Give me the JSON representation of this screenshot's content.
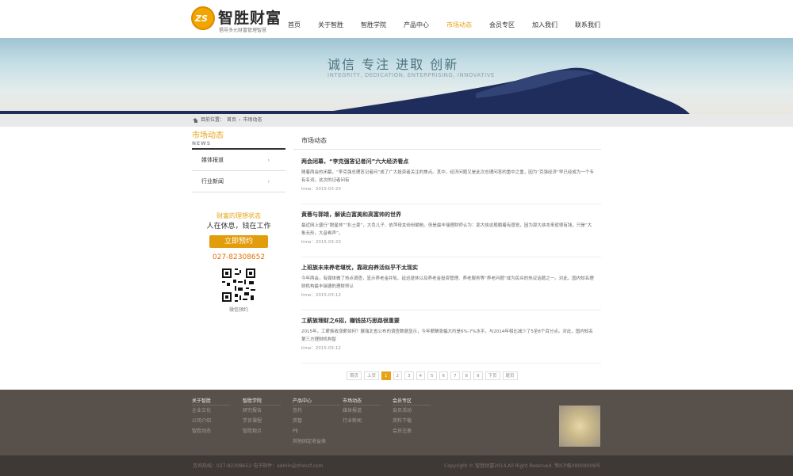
{
  "header": {
    "brand": "智胜财富",
    "logo_mark": "ZS",
    "slogan": "倡导多元财富管理智慧",
    "nav": [
      "首页",
      "关于智胜",
      "智胜学院",
      "产品中心",
      "市场动态",
      "会员专区",
      "加入我们",
      "联系我们"
    ],
    "active_nav": "市场动态"
  },
  "banner": {
    "title": "诚信 专注 进取 创新",
    "subtitle": "INTEGRITY, DEDICATION, ENTERPRISING, INNOVATIVE"
  },
  "breadcrumb": {
    "prefix": "目前位置：",
    "items": [
      "首页",
      "市场动态"
    ],
    "separator": "›"
  },
  "sidebar": {
    "title": "市场动态",
    "title_en": "NEWS",
    "items": [
      {
        "label": "媒体报道",
        "arrow": "›"
      },
      {
        "label": "行业新闻",
        "arrow": "›"
      }
    ]
  },
  "promo": {
    "line1": "财富的理想状态",
    "line2": "人在休息，钱在工作",
    "button": "立即预约",
    "phone": "027-82308652",
    "qr_caption": "微信预约"
  },
  "main": {
    "section_title": "市场动态",
    "news": [
      {
        "title": "两会闭幕，“李克强答记者问”六大经济看点",
        "desc": "随着两会的闭幕，“李克强总理答记者问”成了广大投资者关注的焦点。其中，经济问题又是此次总理问答的重中之重，因为“克强经济”早已经成为一个专有名词。这次的记者问有",
        "time": "time：2015-03-20"
      },
      {
        "title": "黄蓉与郭靖，解读白富美和高富帅的世界",
        "desc": "最近网上盛行“脱星帅”“扒土豪”，大负儿子、依萍母女纷纷躺枪。但是最丰瑞理财师认为：郭大侠这般躺着有感觉，因为郭大侠本来就很有钱，只是“大象无形，大音希声”。",
        "time": "time：2015-03-20"
      },
      {
        "title": "上班族未来养老堪忧，靠政府养活似乎不太现实",
        "desc": "今年两会，有媒体做了热点调查，显示养老金并轨、延迟退休以及养老金投资管理、养老服务等“养老问题”成为民众的热议话题之一。对此，国内知名理财机构最丰瑞德的理财师认",
        "time": "time：2015-03-12"
      },
      {
        "title": "工薪族理财之6招，赚钱技巧思路很重要",
        "desc": "2015年，工薪族收涨薪如何？展瑞北省公布的调查数据显示，今年薪酬涨幅大约是6%-7%水平，与2014年相比减少了5至8个百分点。对此，国内知名第三方理财机构智",
        "time": "time：2015-03-12"
      }
    ],
    "pager": [
      "首页",
      "上页",
      "1",
      "2",
      "3",
      "4",
      "5",
      "6",
      "7",
      "8",
      "9",
      "下页",
      "尾页"
    ],
    "current_page": "1"
  },
  "footer": {
    "columns": [
      {
        "heading": "关于智胜",
        "links": [
          "企业文化",
          "公司介绍",
          "智胜动态"
        ]
      },
      {
        "heading": "智胜学院",
        "links": [
          "研究报告",
          "学员课程",
          "智胜观点"
        ]
      },
      {
        "heading": "产品中心",
        "links": [
          "信托",
          "资管",
          "PE",
          "其他固定收益类"
        ]
      },
      {
        "heading": "市场动态",
        "links": [
          "媒体报道",
          "行业新闻"
        ]
      },
      {
        "heading": "会员专区",
        "links": [
          "会员活动",
          "资料下载",
          "会员注册"
        ]
      }
    ],
    "left": "咨询热线：027-82308652 电子邮件：admin@zhsncf.com",
    "right": "Copyright © 智胜财富2014,All Right Reserved. 鄂ICP备08004008号"
  },
  "colors": {
    "accent": "#e6a317",
    "footer_bg": "#58504a",
    "bottom_bg": "#3f3935",
    "breadcrumb_bg": "#e9e9e9"
  },
  "icons": [
    "home-icon",
    "chevron-right-icon",
    "qr-code-icon",
    "logo-icon"
  ]
}
